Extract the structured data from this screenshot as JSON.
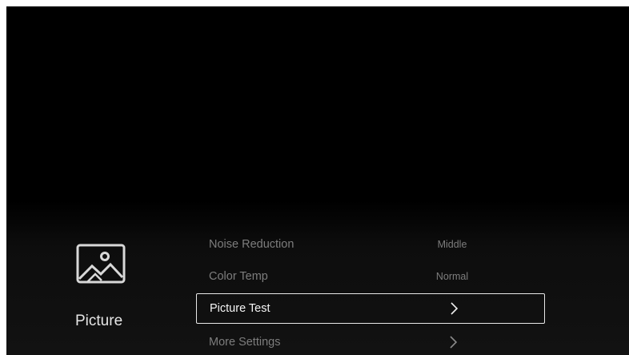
{
  "category": {
    "icon": "picture-icon",
    "label": "Picture"
  },
  "menu": {
    "items": [
      {
        "label": "Noise Reduction",
        "value": "Middle",
        "icon": null,
        "selected": false
      },
      {
        "label": "Color Temp",
        "value": "Normal",
        "icon": null,
        "selected": false
      },
      {
        "label": "Picture Test",
        "value": null,
        "icon": "chevron-right-icon",
        "selected": true
      },
      {
        "label": "More Settings",
        "value": null,
        "icon": "chevron-right-icon",
        "selected": false
      }
    ]
  },
  "colors": {
    "background": "#000000",
    "text_dim": "#7d7d7d",
    "text_active": "#f5f5f5",
    "focus_border": "#e8e8e8"
  }
}
